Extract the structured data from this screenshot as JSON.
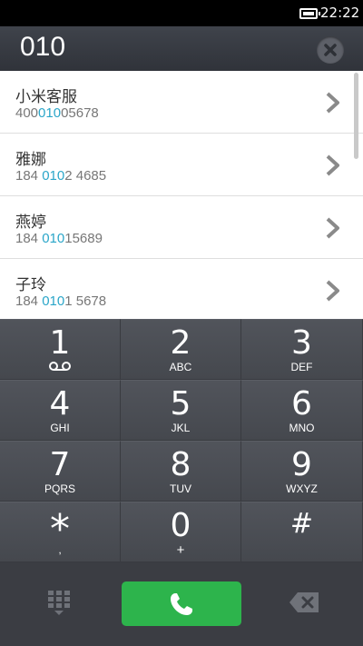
{
  "status_bar": {
    "time": "22:22",
    "battery_icon": "battery-icon"
  },
  "number_display": {
    "value": "010",
    "clear_icon": "clear-circle-icon"
  },
  "contacts": [
    {
      "name": "小米客服",
      "number_pre": "400",
      "number_hl": "010",
      "number_post": "05678"
    },
    {
      "name": "雅娜",
      "number_pre": "184 ",
      "number_hl": "010",
      "number_post": "2 4685"
    },
    {
      "name": "燕婷",
      "number_pre": "184 ",
      "number_hl": "010",
      "number_post": "15689"
    },
    {
      "name": "子玲",
      "number_pre": "184 ",
      "number_hl": "010",
      "number_post": "1 5678"
    }
  ],
  "keypad": [
    {
      "digit": "1",
      "letters": ""
    },
    {
      "digit": "2",
      "letters": "ABC"
    },
    {
      "digit": "3",
      "letters": "DEF"
    },
    {
      "digit": "4",
      "letters": "GHI"
    },
    {
      "digit": "5",
      "letters": "JKL"
    },
    {
      "digit": "6",
      "letters": "MNO"
    },
    {
      "digit": "7",
      "letters": "PQRS"
    },
    {
      "digit": "8",
      "letters": "TUV"
    },
    {
      "digit": "9",
      "letters": "WXYZ"
    },
    {
      "digit": "*",
      "letters": ","
    },
    {
      "digit": "0",
      "letters": "+"
    },
    {
      "digit": "#",
      "letters": ""
    }
  ],
  "colors": {
    "accent_highlight": "#2ba6c9",
    "call_green": "#2db44c",
    "keypad_bg": "#4b4e55"
  },
  "icons": {
    "voicemail": "voicemail-icon",
    "call": "phone-icon",
    "dialpad": "dialpad-icon",
    "backspace": "backspace-icon",
    "chevron": "chevron-right-icon"
  }
}
